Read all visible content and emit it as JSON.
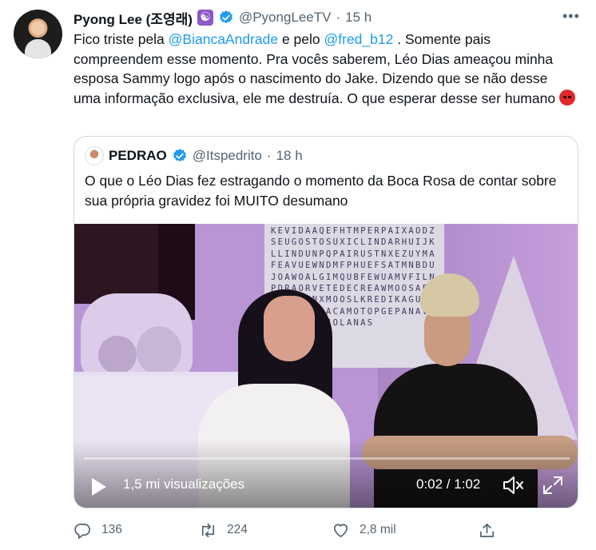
{
  "tweet": {
    "author_name": "Pyong Lee (조영래)",
    "author_badge": "☯",
    "handle": "@PyongLeeTV",
    "separator": "·",
    "time": "15 h",
    "more": "•••",
    "text": {
      "p1": "Fico triste pela ",
      "m1": "@BiancaAndrade",
      "p2": " e pelo ",
      "m2": "@fred_b12",
      "p3": " . Somente pais compreendem esse momento. Pra vocês saberem, Léo Dias ameaçou minha esposa Sammy logo após o nascimento do Jake. Dizendo que se não desse uma informação exclusiva, ele me destruía. O que esperar desse ser humano "
    }
  },
  "quoted": {
    "author_name": "PEDRAO",
    "handle": "@Itspedrito",
    "separator": "·",
    "time": "18 h",
    "text": "O que o Léo Dias fez estragando o momento da Boca Rosa de contar sobre sua própria gravidez foi MUITO desumano",
    "video": {
      "board_letters": "KEVIDAAQEFHTMPERPAIXAODZSEUGOSTOSUXICLINDARHUIJKLLINDUNPQPAIRUSTNXEZUYMAFEAVUEWNDMFPHUEFSATMNBDUJOAWOALGIMQUBFEWUAMVFILNPDRAORVETEDECREAWMOOSAFAEMTSHUNXMOOSLKREDIKAGUEHOOPUSCASACAMOTOPGEPANAVTCAGOMOEDJOLANAS",
      "progress": 0.0,
      "views": "1,5 mi visualizações",
      "time": "0:02 / 1:02"
    }
  },
  "actions": {
    "replies": "136",
    "retweets": "224",
    "likes": "2,8 mil"
  },
  "icons": {
    "verified": "verified-badge-icon",
    "reply": "reply-icon",
    "retweet": "retweet-icon",
    "like": "heart-icon",
    "share": "share-icon"
  },
  "colors": {
    "link": "#1d9bf0",
    "muted": "#536471",
    "verified": "#1d9bf0"
  }
}
